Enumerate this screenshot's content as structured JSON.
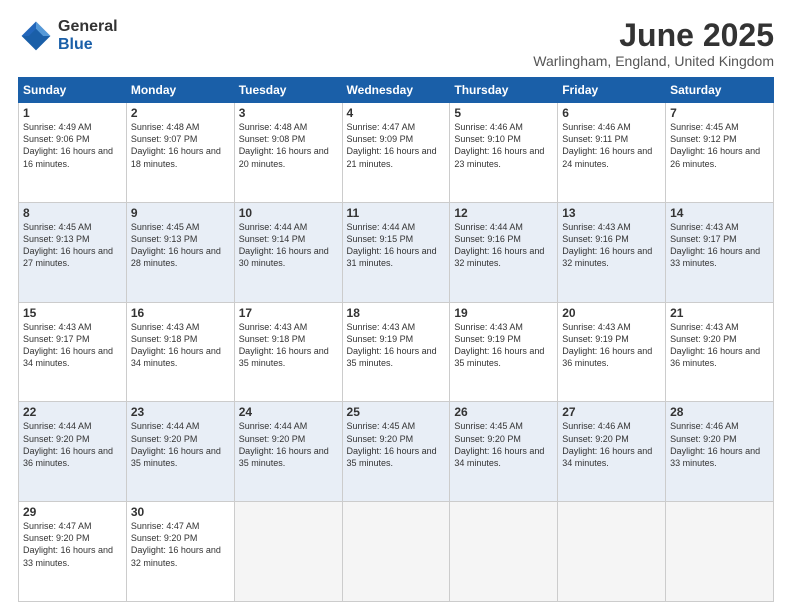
{
  "logo": {
    "general": "General",
    "blue": "Blue"
  },
  "title": "June 2025",
  "subtitle": "Warlingham, England, United Kingdom",
  "headers": [
    "Sunday",
    "Monday",
    "Tuesday",
    "Wednesday",
    "Thursday",
    "Friday",
    "Saturday"
  ],
  "rows": [
    [
      {
        "day": "1",
        "sunrise": "Sunrise: 4:49 AM",
        "sunset": "Sunset: 9:06 PM",
        "daylight": "Daylight: 16 hours and 16 minutes."
      },
      {
        "day": "2",
        "sunrise": "Sunrise: 4:48 AM",
        "sunset": "Sunset: 9:07 PM",
        "daylight": "Daylight: 16 hours and 18 minutes."
      },
      {
        "day": "3",
        "sunrise": "Sunrise: 4:48 AM",
        "sunset": "Sunset: 9:08 PM",
        "daylight": "Daylight: 16 hours and 20 minutes."
      },
      {
        "day": "4",
        "sunrise": "Sunrise: 4:47 AM",
        "sunset": "Sunset: 9:09 PM",
        "daylight": "Daylight: 16 hours and 21 minutes."
      },
      {
        "day": "5",
        "sunrise": "Sunrise: 4:46 AM",
        "sunset": "Sunset: 9:10 PM",
        "daylight": "Daylight: 16 hours and 23 minutes."
      },
      {
        "day": "6",
        "sunrise": "Sunrise: 4:46 AM",
        "sunset": "Sunset: 9:11 PM",
        "daylight": "Daylight: 16 hours and 24 minutes."
      },
      {
        "day": "7",
        "sunrise": "Sunrise: 4:45 AM",
        "sunset": "Sunset: 9:12 PM",
        "daylight": "Daylight: 16 hours and 26 minutes."
      }
    ],
    [
      {
        "day": "8",
        "sunrise": "Sunrise: 4:45 AM",
        "sunset": "Sunset: 9:13 PM",
        "daylight": "Daylight: 16 hours and 27 minutes."
      },
      {
        "day": "9",
        "sunrise": "Sunrise: 4:45 AM",
        "sunset": "Sunset: 9:13 PM",
        "daylight": "Daylight: 16 hours and 28 minutes."
      },
      {
        "day": "10",
        "sunrise": "Sunrise: 4:44 AM",
        "sunset": "Sunset: 9:14 PM",
        "daylight": "Daylight: 16 hours and 30 minutes."
      },
      {
        "day": "11",
        "sunrise": "Sunrise: 4:44 AM",
        "sunset": "Sunset: 9:15 PM",
        "daylight": "Daylight: 16 hours and 31 minutes."
      },
      {
        "day": "12",
        "sunrise": "Sunrise: 4:44 AM",
        "sunset": "Sunset: 9:16 PM",
        "daylight": "Daylight: 16 hours and 32 minutes."
      },
      {
        "day": "13",
        "sunrise": "Sunrise: 4:43 AM",
        "sunset": "Sunset: 9:16 PM",
        "daylight": "Daylight: 16 hours and 32 minutes."
      },
      {
        "day": "14",
        "sunrise": "Sunrise: 4:43 AM",
        "sunset": "Sunset: 9:17 PM",
        "daylight": "Daylight: 16 hours and 33 minutes."
      }
    ],
    [
      {
        "day": "15",
        "sunrise": "Sunrise: 4:43 AM",
        "sunset": "Sunset: 9:17 PM",
        "daylight": "Daylight: 16 hours and 34 minutes."
      },
      {
        "day": "16",
        "sunrise": "Sunrise: 4:43 AM",
        "sunset": "Sunset: 9:18 PM",
        "daylight": "Daylight: 16 hours and 34 minutes."
      },
      {
        "day": "17",
        "sunrise": "Sunrise: 4:43 AM",
        "sunset": "Sunset: 9:18 PM",
        "daylight": "Daylight: 16 hours and 35 minutes."
      },
      {
        "day": "18",
        "sunrise": "Sunrise: 4:43 AM",
        "sunset": "Sunset: 9:19 PM",
        "daylight": "Daylight: 16 hours and 35 minutes."
      },
      {
        "day": "19",
        "sunrise": "Sunrise: 4:43 AM",
        "sunset": "Sunset: 9:19 PM",
        "daylight": "Daylight: 16 hours and 35 minutes."
      },
      {
        "day": "20",
        "sunrise": "Sunrise: 4:43 AM",
        "sunset": "Sunset: 9:19 PM",
        "daylight": "Daylight: 16 hours and 36 minutes."
      },
      {
        "day": "21",
        "sunrise": "Sunrise: 4:43 AM",
        "sunset": "Sunset: 9:20 PM",
        "daylight": "Daylight: 16 hours and 36 minutes."
      }
    ],
    [
      {
        "day": "22",
        "sunrise": "Sunrise: 4:44 AM",
        "sunset": "Sunset: 9:20 PM",
        "daylight": "Daylight: 16 hours and 36 minutes."
      },
      {
        "day": "23",
        "sunrise": "Sunrise: 4:44 AM",
        "sunset": "Sunset: 9:20 PM",
        "daylight": "Daylight: 16 hours and 35 minutes."
      },
      {
        "day": "24",
        "sunrise": "Sunrise: 4:44 AM",
        "sunset": "Sunset: 9:20 PM",
        "daylight": "Daylight: 16 hours and 35 minutes."
      },
      {
        "day": "25",
        "sunrise": "Sunrise: 4:45 AM",
        "sunset": "Sunset: 9:20 PM",
        "daylight": "Daylight: 16 hours and 35 minutes."
      },
      {
        "day": "26",
        "sunrise": "Sunrise: 4:45 AM",
        "sunset": "Sunset: 9:20 PM",
        "daylight": "Daylight: 16 hours and 34 minutes."
      },
      {
        "day": "27",
        "sunrise": "Sunrise: 4:46 AM",
        "sunset": "Sunset: 9:20 PM",
        "daylight": "Daylight: 16 hours and 34 minutes."
      },
      {
        "day": "28",
        "sunrise": "Sunrise: 4:46 AM",
        "sunset": "Sunset: 9:20 PM",
        "daylight": "Daylight: 16 hours and 33 minutes."
      }
    ],
    [
      {
        "day": "29",
        "sunrise": "Sunrise: 4:47 AM",
        "sunset": "Sunset: 9:20 PM",
        "daylight": "Daylight: 16 hours and 33 minutes."
      },
      {
        "day": "30",
        "sunrise": "Sunrise: 4:47 AM",
        "sunset": "Sunset: 9:20 PM",
        "daylight": "Daylight: 16 hours and 32 minutes."
      },
      null,
      null,
      null,
      null,
      null
    ]
  ]
}
